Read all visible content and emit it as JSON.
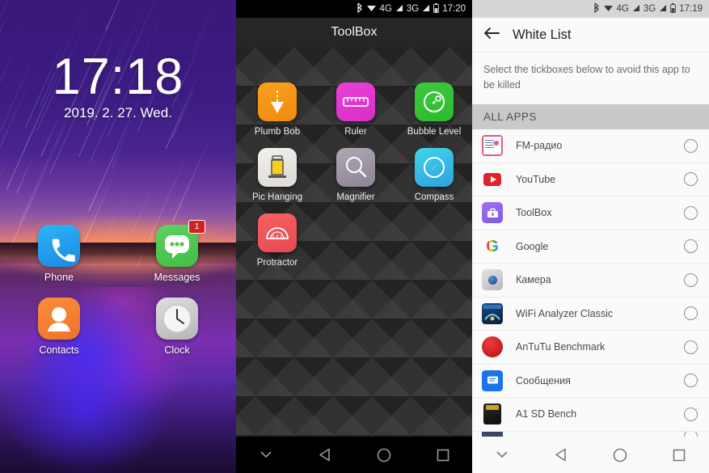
{
  "home": {
    "clock_time": "17:18",
    "clock_date": "2019. 2. 27. Wed.",
    "apps": [
      {
        "label": "Phone",
        "icon": "phone-icon",
        "badge": null
      },
      {
        "label": "Messages",
        "icon": "message-bubble-icon",
        "badge": "1"
      },
      {
        "label": "Contacts",
        "icon": "contacts-person-icon",
        "badge": null
      },
      {
        "label": "Clock",
        "icon": "analog-clock-icon",
        "badge": null
      }
    ]
  },
  "toolbox": {
    "status": {
      "time": "17:20",
      "network_1": "4G",
      "network_2": "3G",
      "icons": [
        "bluetooth-icon",
        "wifi-icon",
        "signal-icon",
        "signal-icon",
        "battery-icon"
      ]
    },
    "title": "ToolBox",
    "apps": [
      {
        "label": "Plumb Bob",
        "icon": "plumb-bob-icon",
        "color": "#f9a11b"
      },
      {
        "label": "Ruler",
        "icon": "ruler-icon",
        "color": "#ea3fd8"
      },
      {
        "label": "Bubble Level",
        "icon": "bubble-level-icon",
        "color": "#3cc93c"
      },
      {
        "label": "Pic Hanging",
        "icon": "picture-frame-icon",
        "color": "#f2f0ed"
      },
      {
        "label": "Magnifier",
        "icon": "magnifier-icon",
        "color": "#b0a7b5"
      },
      {
        "label": "Compass",
        "icon": "compass-icon",
        "color": "#3fd6e8"
      },
      {
        "label": "Protractor",
        "icon": "protractor-icon",
        "color": "#f86060"
      }
    ],
    "nav": [
      "chevron-down-icon",
      "back-triangle-icon",
      "home-circle-icon",
      "recents-square-icon"
    ]
  },
  "whitelist": {
    "status": {
      "time": "17:19",
      "network_1": "4G",
      "network_2": "3G",
      "icons": [
        "bluetooth-icon",
        "wifi-icon",
        "signal-icon",
        "signal-icon",
        "battery-icon"
      ]
    },
    "title": "White List",
    "back_icon": "back-arrow-icon",
    "description": "Select the tickboxes below to avoid this app to be killed",
    "section_header": "ALL APPS",
    "rows": [
      {
        "name": "FM-радио",
        "icon": "fm-radio-icon",
        "checked": false
      },
      {
        "name": "YouTube",
        "icon": "youtube-icon",
        "checked": false
      },
      {
        "name": "ToolBox",
        "icon": "toolbox-icon",
        "checked": false
      },
      {
        "name": "Google",
        "icon": "google-icon",
        "checked": false
      },
      {
        "name": "Камера",
        "icon": "camera-icon",
        "checked": false
      },
      {
        "name": "WiFi Analyzer Classic",
        "icon": "wifi-analyzer-icon",
        "checked": false
      },
      {
        "name": "AnTuTu Benchmark",
        "icon": "antutu-icon",
        "checked": false
      },
      {
        "name": "Сообщения",
        "icon": "messages-icon",
        "checked": false
      },
      {
        "name": "A1 SD Bench",
        "icon": "sd-card-icon",
        "checked": false
      }
    ],
    "nav": [
      "chevron-down-icon",
      "back-triangle-icon",
      "home-circle-icon",
      "recents-square-icon"
    ]
  },
  "colors": {
    "accent_purple": "#3b1878",
    "toolbox_bg": "#323232",
    "whitelist_bg": "#fafafa",
    "section_bg": "#c9c9c9",
    "badge_red": "#d32020"
  }
}
